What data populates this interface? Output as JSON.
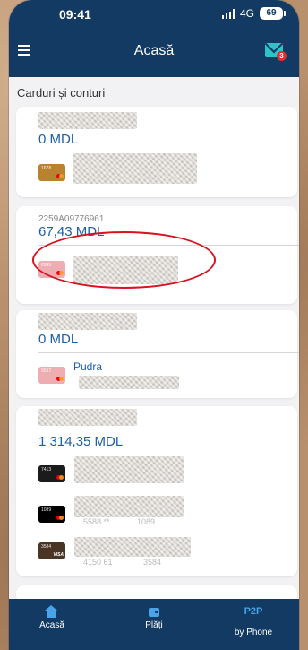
{
  "status_bar": {
    "time": "09:41",
    "network": "4G",
    "battery": "69"
  },
  "header": {
    "title": "Acasă",
    "notification_count": "3"
  },
  "section": {
    "title": "Carduri și conturi"
  },
  "accounts": [
    {
      "account_number": "",
      "balance": "0 MDL",
      "cards": [
        {
          "last4": "1678",
          "name": ""
        }
      ]
    },
    {
      "account_number": "2259A09776961",
      "balance": "67,43 MDL",
      "cards": [
        {
          "last4": "0345",
          "name": ""
        }
      ]
    },
    {
      "account_number": "",
      "balance": "0 MDL",
      "cards": [
        {
          "last4": "9057",
          "name": "Pudra"
        }
      ]
    },
    {
      "account_number": "",
      "balance": "1 314,35 MDL",
      "cards": [
        {
          "last4": "7413",
          "name": ""
        },
        {
          "last4": "1089",
          "name": ""
        },
        {
          "last4": "3584",
          "name": ""
        }
      ]
    }
  ],
  "ghost_text": {
    "c2": "5588 **",
    "c2b": "1089",
    "c3": "4150 61",
    "c3b": "3584"
  },
  "bottom_nav": {
    "home": "Acasă",
    "payments": "Plăți",
    "p2p_icon": "P2P",
    "p2p": "by Phone"
  },
  "colors": {
    "header": "#123a63",
    "accent": "#1d5ea6",
    "highlight": "#d9121f"
  }
}
